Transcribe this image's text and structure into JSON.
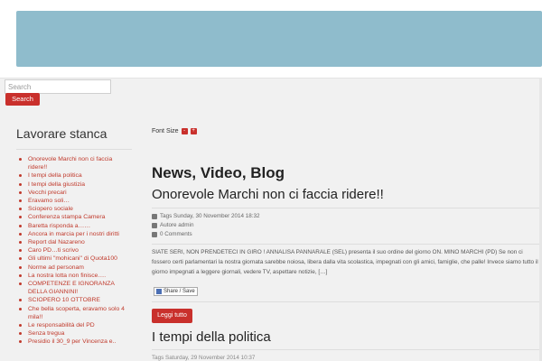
{
  "search": {
    "placeholder": "Search",
    "button_label": "Search"
  },
  "sidebar": {
    "title": "Lavorare stanca",
    "items": [
      "Onorevole Marchi non ci faccia ridere!!",
      "I tempi della politica",
      "I tempi della giustizia",
      "Vecchi precari",
      "Eravamo soli…",
      "Sciopero sociale",
      "Conferenza stampa Camera",
      "Baretta risponda a……",
      "Ancora in marcia per i nostri diritti",
      "Report dal Nazareno",
      "Caro PD…ti scrivo",
      "Gli ultimi \"mohicani\" di Quota100",
      "Norme ad personam",
      "La nostra lotta non finisce….",
      "COMPETENZE E IGNORANZA DELLA GIANNINI!",
      "SCIOPERO 10 OTTOBRE",
      "Che bella scoperta, eravamo solo 4 mila!!",
      "Le responsabilità del PD",
      "Senza tregua",
      "Presidio il 30_9 per Vincenza e.."
    ]
  },
  "main": {
    "font_size_label": "Font Size",
    "font_minus": "-",
    "font_plus": "+",
    "section_title": "News, Video, Blog",
    "article": {
      "title": "Onorevole Marchi non ci faccia ridere!!",
      "tags_date": "Tags Sunday, 30 November 2014 18:32",
      "author": "Autore admin",
      "comments": "0 Comments",
      "body": "SIATE SERI, NON PRENDETECI IN GIRO ! ANNALISA PANNARALE (SEL) presenta il suo ordine del giorno ON. MINO MARCHI (PD) Se non ci fossero certi parlamentari la nostra giornata sarebbe noiosa, libera dalla vita scolastica, impegnati con gli amici, famiglie, che palle! Invece siamo tutto il giorno impegnati a leggere giornali, vedere TV, aspettare notizie, […]",
      "share_label": "Share / Save",
      "read_more": "Leggi tutto"
    },
    "article2": {
      "title": "I tempi della politica",
      "meta": "Tags Saturday, 29 November 2014 10:37"
    }
  },
  "colors": {
    "accent": "#c9302c",
    "banner": "#8fbccc",
    "link": "#c0392b"
  }
}
